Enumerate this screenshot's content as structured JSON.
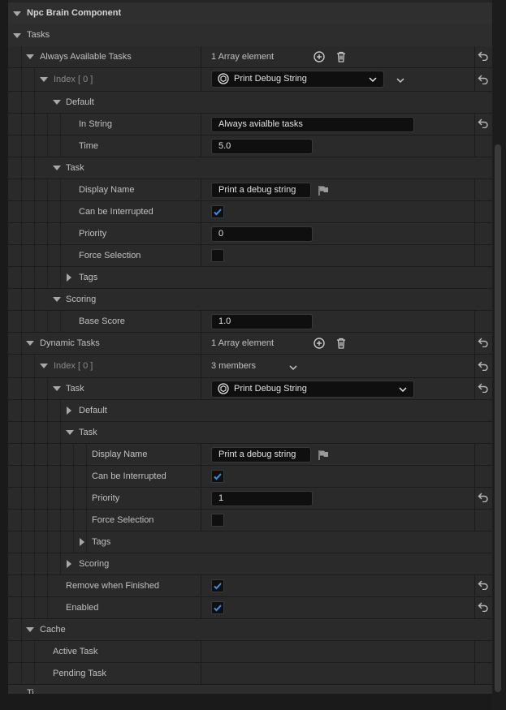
{
  "component": {
    "title": "Npc Brain Component"
  },
  "categories": {
    "tasks": "Tasks",
    "cache": "Cache",
    "next_partial": "Ti"
  },
  "always_available": {
    "label": "Always Available Tasks",
    "count": "1 Array element",
    "index_label": "Index [ 0 ]",
    "class_value": "Print Debug String",
    "default_section": "Default",
    "in_string_label": "In String",
    "in_string_value": "Always avialble tasks",
    "time_label": "Time",
    "time_value": "5.0",
    "task_section": "Task",
    "display_name_label": "Display Name",
    "display_name_value": "Print a debug string",
    "interruptible_label": "Can be Interrupted",
    "interruptible": true,
    "priority_label": "Priority",
    "priority_value": "0",
    "force_label": "Force Selection",
    "force": false,
    "tags_label": "Tags",
    "scoring_section": "Scoring",
    "base_score_label": "Base Score",
    "base_score_value": "1.0"
  },
  "dynamic": {
    "label": "Dynamic Tasks",
    "count": "1 Array element",
    "index_label": "Index [ 0 ]",
    "members": "3 members",
    "task_label": "Task",
    "class_value": "Print Debug String",
    "default_label": "Default",
    "inner_task_label": "Task",
    "display_name_label": "Display Name",
    "display_name_value": "Print a debug string",
    "interruptible_label": "Can be Interrupted",
    "interruptible": true,
    "priority_label": "Priority",
    "priority_value": "1",
    "force_label": "Force Selection",
    "force": false,
    "tags_label": "Tags",
    "scoring_label": "Scoring",
    "remove_label": "Remove when Finished",
    "remove": true,
    "enabled_label": "Enabled",
    "enabled": true
  },
  "cache": {
    "active_task_label": "Active Task",
    "pending_task_label": "Pending Task"
  },
  "colors": {
    "accent_check": "#3a8ee6",
    "background": "#242424",
    "input_bg": "#0f0f0f"
  },
  "icons": [
    "add-element-icon",
    "delete-elements-icon",
    "reset-to-default-icon",
    "class-picker-icon",
    "browse-flag-icon",
    "chevron-down-icon"
  ]
}
